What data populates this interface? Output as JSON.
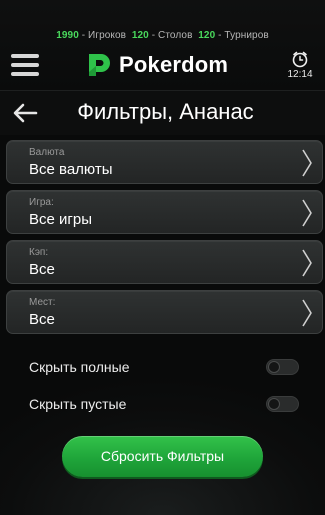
{
  "stats": {
    "players_count": "1990",
    "players_label": " - Игроков",
    "tables_count": "120",
    "tables_label": " - Столов",
    "tournaments_count": "120",
    "tournaments_label": " - Турниров"
  },
  "header": {
    "brand": "Pokerdom",
    "time": "12:14",
    "menu_icon": "hamburger-menu-icon",
    "clock_icon": "alarm-clock-icon"
  },
  "titlebar": {
    "title": "Фильтры, Ананас",
    "back_icon": "arrow-left-icon"
  },
  "filters": [
    {
      "label": "Валюта",
      "value": "Все валюты"
    },
    {
      "label": "Игра:",
      "value": "Все игры"
    },
    {
      "label": "Кэп:",
      "value": "Все"
    },
    {
      "label": "Мест:",
      "value": "Все"
    }
  ],
  "toggles": {
    "hide_full": {
      "label": "Скрыть полные",
      "on": false
    },
    "hide_empty": {
      "label": "Скрыть пустые",
      "on": false
    }
  },
  "reset_button": {
    "label": "Сбросить Фильтры"
  },
  "colors": {
    "accent_green": "#49d85c",
    "button_green": "#1fa53a",
    "background": "#0c0d0d"
  }
}
